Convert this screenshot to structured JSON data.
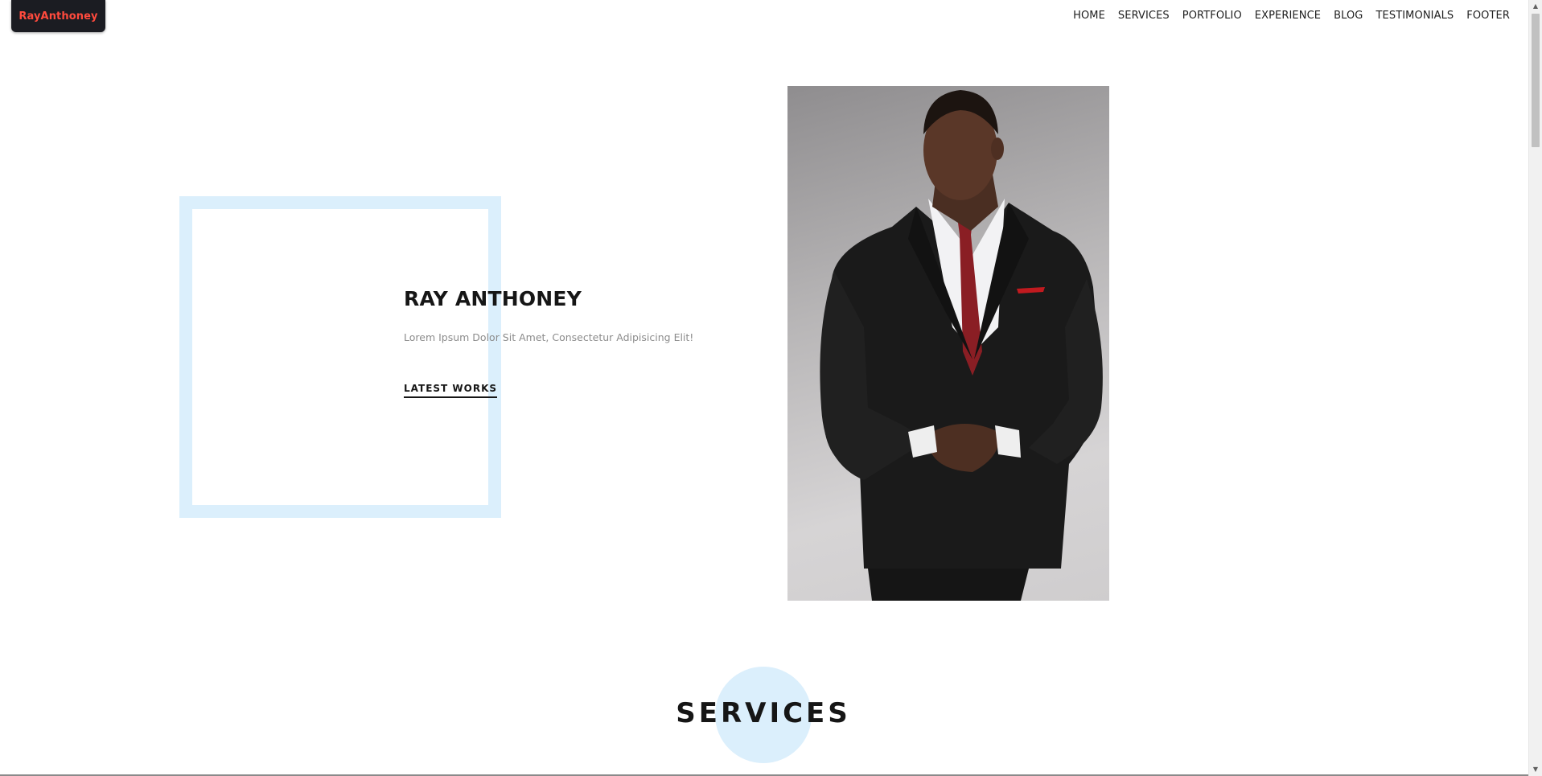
{
  "header": {
    "logo_text": "RayAnthoney",
    "nav": [
      {
        "label": "HOME"
      },
      {
        "label": "SERVICES"
      },
      {
        "label": "PORTFOLIO"
      },
      {
        "label": "EXPERIENCE"
      },
      {
        "label": "BLOG"
      },
      {
        "label": "TESTIMONIALS"
      },
      {
        "label": "FOOTER"
      }
    ]
  },
  "hero": {
    "title": "RAY ANTHONEY",
    "subtitle": "Lorem Ipsum Dolor Sit Amet, Consectetur Adipisicing Elit!",
    "cta_label": "LATEST WORKS"
  },
  "services": {
    "title": "SERVICES"
  },
  "colors": {
    "accent": "#ff4a3d",
    "logo_bg": "#1b1c22",
    "frame": "#dbeffc",
    "text": "#161616",
    "muted": "#8c8c8c"
  },
  "icons": {
    "scroll_up": "chevron-up-icon",
    "scroll_down": "chevron-down-icon"
  }
}
